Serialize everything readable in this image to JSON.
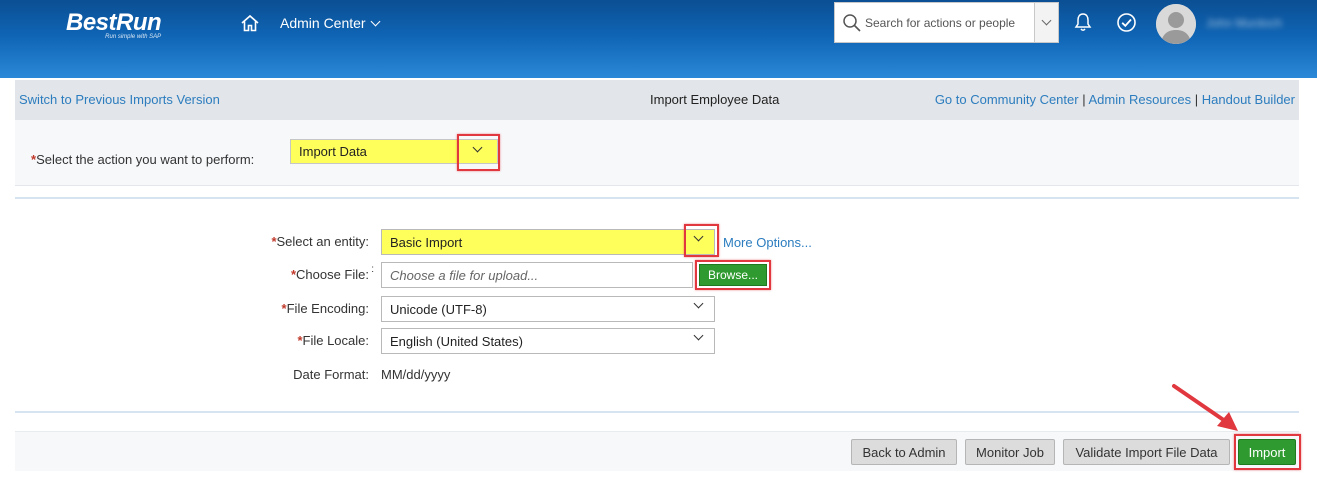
{
  "shell": {
    "logo_text_a": "Best",
    "logo_text_b": "Run",
    "logo_tagline": "Run simple with SAP",
    "home_icon": "home-icon",
    "nav_menu_label": "Admin Center",
    "search_placeholder": "Search for actions or people",
    "notification_icon": "bell-icon",
    "todo_icon": "check-circle-icon",
    "user_name": "John Murdoch"
  },
  "subheader": {
    "switch_link": "Switch to Previous Imports Version",
    "page_title": "Import Employee Data",
    "community_link": "Go to Community Center",
    "separator": "|",
    "admin_resources_link": "Admin Resources",
    "handout_link": "Handout Builder"
  },
  "action": {
    "required_mark": "*",
    "label": "Select the action you want to perform:",
    "selected": "Import Data"
  },
  "form": {
    "entity_label": "Select an entity:",
    "entity_value": "Basic Import",
    "more_options": "More Options...",
    "file_label": "Choose File:",
    "file_colon": ":",
    "file_placeholder": "Choose a file for upload...",
    "browse_label": "Browse...",
    "encoding_label": "File Encoding:",
    "encoding_value": "Unicode (UTF-8)",
    "locale_label": "File Locale:",
    "locale_value": "English (United States)",
    "date_label": "Date Format:",
    "date_value": "MM/dd/yyyy"
  },
  "footer": {
    "back_label": "Back to Admin",
    "monitor_label": "Monitor Job",
    "validate_label": "Validate Import File Data",
    "import_label": "Import"
  },
  "colors": {
    "highlight_yellow": "#ffff5c",
    "accent_green": "#2f9a2f",
    "callout_red": "#e0383e",
    "link_blue": "#2c7dbf",
    "shell_blue": "#0f64b4"
  }
}
